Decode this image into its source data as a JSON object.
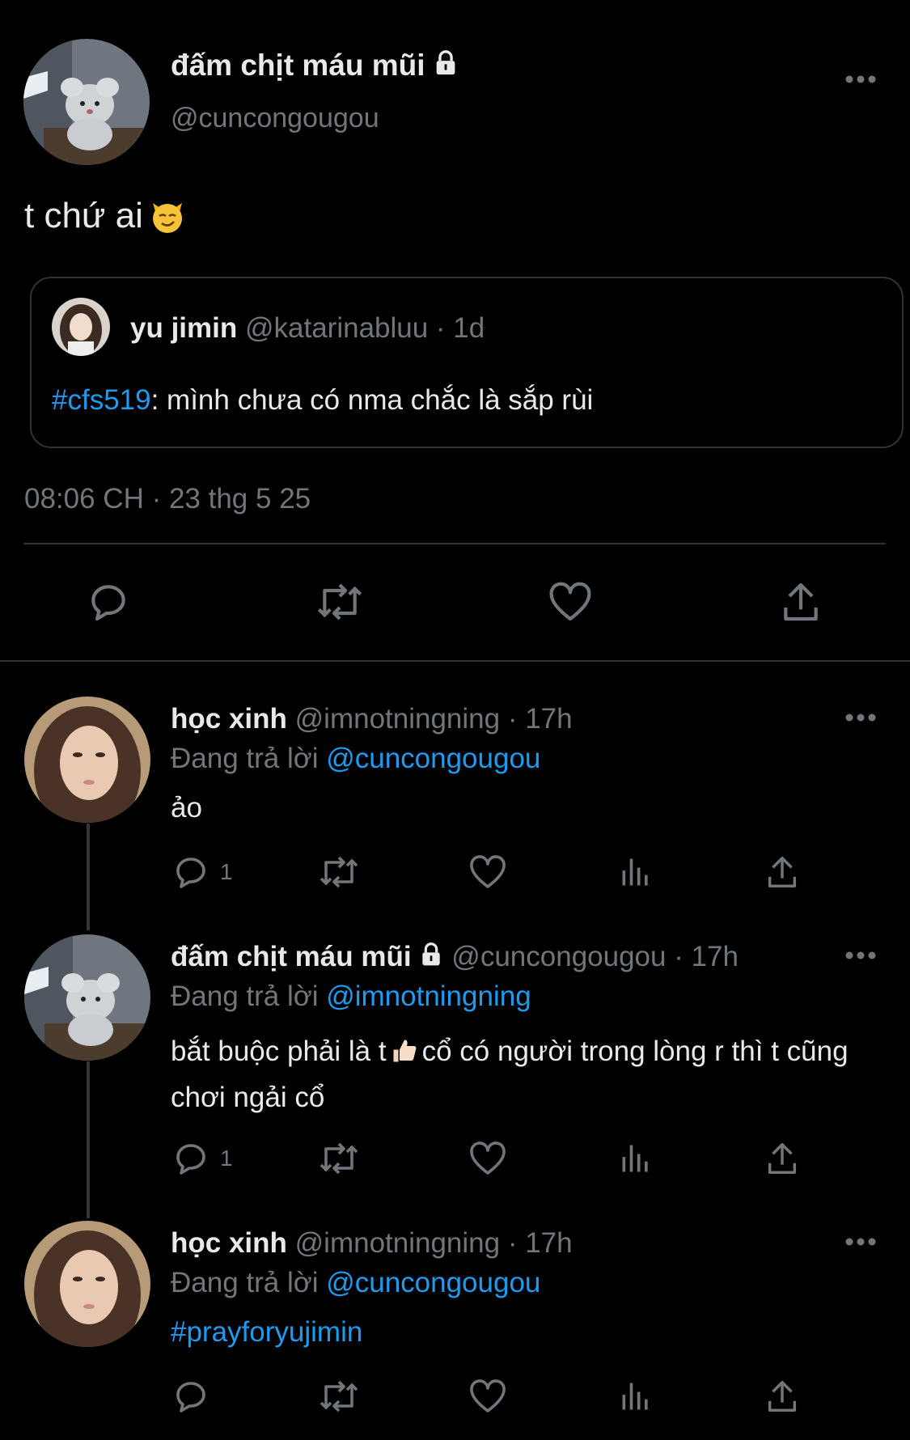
{
  "main_tweet": {
    "name": "đấm chịt máu mũi",
    "handle": "@cuncongougou",
    "text": "t chứ ai",
    "timestamp": "08:06 CH · 23 thg 5 25",
    "quote": {
      "name": "yu jimin",
      "handle_time": "@katarinabluu · 1d",
      "hashtag": "#cfs519",
      "text": ": mình chưa có nma chắc là sắp rùi"
    }
  },
  "replies": [
    {
      "name": "học xinh",
      "meta": "@imnotningning · 17h",
      "replying_label": "Đang trả lời",
      "replying_to": "@cuncongougou",
      "text": "ảo",
      "reply_count": "1"
    },
    {
      "name": "đấm chịt máu mũi",
      "meta": "@cuncongougou · 17h",
      "replying_label": "Đang trả lời",
      "replying_to": "@imnotningning",
      "text_before": "bắt buộc phải là t",
      "text_after": "cổ có người trong lòng r thì t cũng chơi ngải cổ",
      "reply_count": "1"
    },
    {
      "name": "học xinh",
      "meta": "@imnotningning · 17h",
      "replying_label": "Đang trả lời",
      "replying_to": "@cuncongougou",
      "hashtag": "#prayforyujimin"
    }
  ],
  "icons": {
    "reply": "speech-bubble-icon",
    "retweet": "retweet-icon",
    "like": "heart-icon",
    "views": "bar-chart-icon",
    "share": "share-icon",
    "more": "more-dots-icon",
    "lock": "lock-icon"
  },
  "colors": {
    "background": "#000000",
    "text": "#e7e9ea",
    "muted": "#71767b",
    "accent": "#1d9bf0",
    "divider": "#2f3336"
  }
}
